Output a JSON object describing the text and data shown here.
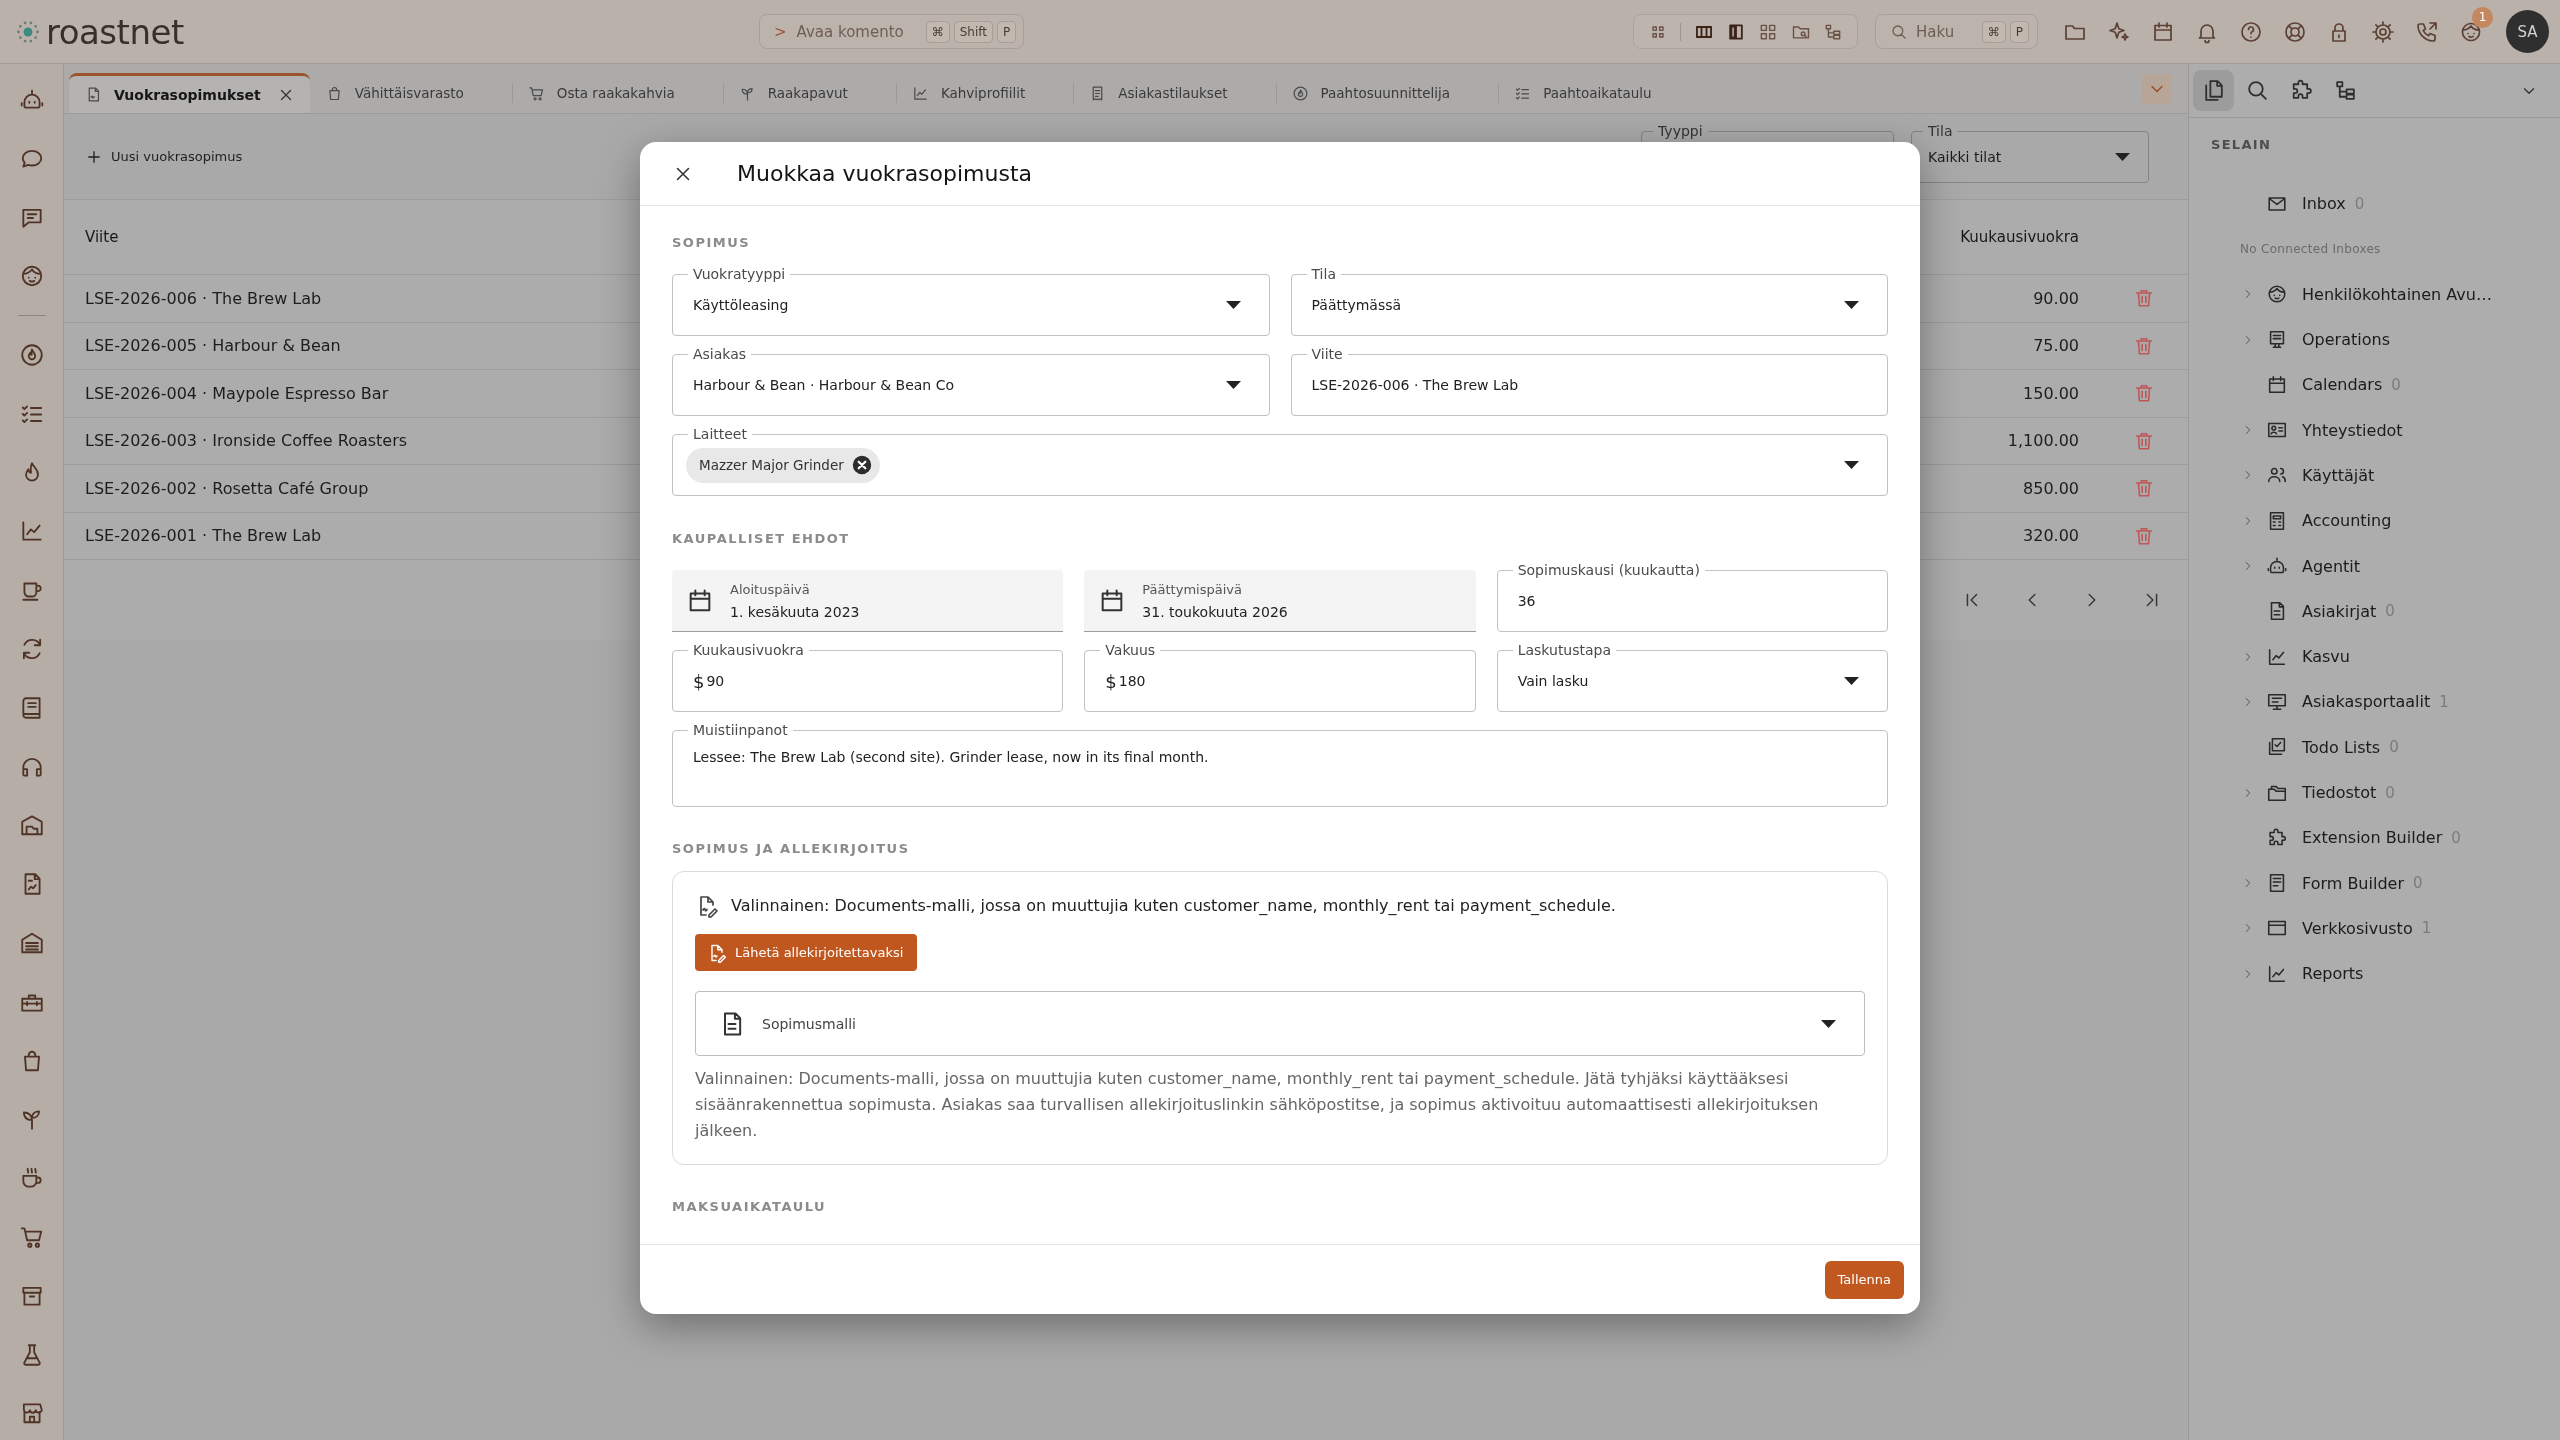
{
  "header": {
    "logo": "roastnet",
    "command": {
      "prompt": ">",
      "label": "Avaa komento",
      "keys": [
        "⌘",
        "Shift",
        "P"
      ]
    },
    "search": {
      "label": "Haku",
      "keys": [
        "⌘",
        "P"
      ]
    },
    "notification_badge": "1",
    "avatar": "SA"
  },
  "tabs": [
    {
      "kind": "contract",
      "label": "Vuokrasopimukset",
      "selected": true
    },
    {
      "kind": "bag",
      "label": "Vähittäisvarasto",
      "selected": false
    },
    {
      "kind": "cart",
      "label": "Osta raakakahvia",
      "selected": false
    },
    {
      "kind": "sprout",
      "label": "Raakapavut",
      "selected": false
    },
    {
      "kind": "linechart",
      "label": "Kahviprofiilit",
      "selected": false
    },
    {
      "kind": "receipt",
      "label": "Asiakastilaukset",
      "selected": false
    },
    {
      "kind": "flamecircle",
      "label": "Paahtosuunnittelija",
      "selected": false
    },
    {
      "kind": "checklist",
      "label": "Paahtoaikataulu",
      "selected": false
    }
  ],
  "toolbar": {
    "new_button": "Uusi vuokrasopimus",
    "filters": [
      {
        "label": "Tyyppi"
      },
      {
        "label": "Tila",
        "value": "Kaikki tilat"
      }
    ]
  },
  "table": {
    "columns": [
      "Viite",
      "Kuukausivuokra"
    ],
    "rows": [
      {
        "reference": "LSE-2026-006 · The Brew Lab",
        "monthly_rent": "90.00"
      },
      {
        "reference": "LSE-2026-005 · Harbour & Bean",
        "monthly_rent": "75.00"
      },
      {
        "reference": "LSE-2026-004 · Maypole Espresso Bar",
        "monthly_rent": "150.00"
      },
      {
        "reference": "LSE-2026-003 · Ironside Coffee Roasters",
        "monthly_rent": "1,100.00"
      },
      {
        "reference": "LSE-2026-002 · Rosetta Café Group",
        "monthly_rent": "850.00"
      },
      {
        "reference": "LSE-2026-001 · The Brew Lab",
        "monthly_rent": "320.00"
      }
    ]
  },
  "modal": {
    "title": "Muokkaa vuokrasopimusta",
    "contract": {
      "heading": "SOPIMUS",
      "fields": [
        {
          "kind": "select",
          "label": "Vuokratyyppi",
          "value": "Käyttöleasing"
        },
        {
          "kind": "select",
          "label": "Tila",
          "value": "Päättymässä"
        },
        {
          "kind": "select",
          "label": "Asiakas",
          "value": "Harbour & Bean · Harbour & Bean Co"
        },
        {
          "kind": "text",
          "label": "Viite",
          "value": "LSE-2026-006 · The Brew Lab"
        },
        {
          "kind": "chips",
          "label": "Laitteet",
          "chips": [
            "Mazzer Major Grinder"
          ]
        }
      ]
    },
    "commercial_terms": {
      "heading": "KAUPALLISET EHDOT",
      "fields": [
        {
          "kind": "date",
          "label": "Aloituspäivä",
          "value": "1. kesäkuuta 2023"
        },
        {
          "kind": "date",
          "label": "Päättymispäivä",
          "value": "31. toukokuuta 2026"
        },
        {
          "kind": "text",
          "label": "Sopimuskausi (kuukautta)",
          "value": "36"
        },
        {
          "kind": "money",
          "label": "Kuukausivuokra",
          "currency": "$",
          "value": "90"
        },
        {
          "kind": "money",
          "label": "Vakuus",
          "currency": "$",
          "value": "180"
        },
        {
          "kind": "select",
          "label": "Laskutustapa",
          "value": "Vain lasku"
        },
        {
          "kind": "textarea",
          "label": "Muistiinpanot",
          "value": "Lessee: The Brew Lab (second site). Grinder lease, now in its final month."
        }
      ]
    },
    "signature": {
      "heading": "SOPIMUS JA ALLEKIRJOITUS",
      "intro": "Valinnainen: Documents-malli, jossa on muuttujia kuten customer_name, monthly_rent tai payment_schedule.",
      "send_button": "Lähetä allekirjoitettavaksi",
      "template": {
        "placeholder": "Sopimusmalli"
      },
      "help": "Valinnainen: Documents-malli, jossa on muuttujia kuten customer_name, monthly_rent tai payment_schedule. Jätä tyhjäksi käyttääksesi sisäänrakennettua sopimusta. Asiakas saa turvallisen allekirjoituslinkin sähköpostitse, ja sopimus aktivoituu automaattisesti allekirjoituksen jälkeen."
    },
    "payment_schedule": {
      "heading": "MAKSUAIKATAULU"
    },
    "save_button": "Tallenna"
  },
  "browser": {
    "tabs": [
      {
        "kind": "files",
        "selected": true
      },
      {
        "kind": "search",
        "selected": false
      },
      {
        "kind": "puzzle",
        "selected": false
      },
      {
        "kind": "tree",
        "selected": false
      }
    ],
    "heading": "SELAIN",
    "inbox": {
      "label": "Inbox",
      "count": "0"
    },
    "inbox_note": "No Connected Inboxes",
    "items": [
      {
        "kind": "face",
        "label": "Henkilökohtainen Avu…",
        "expanded": false
      },
      {
        "kind": "monitor",
        "label": "Operations",
        "expanded": false
      },
      {
        "kind": "calendar",
        "label": "Calendars",
        "count": "0"
      },
      {
        "kind": "contact",
        "label": "Yhteystiedot",
        "expanded": false
      },
      {
        "kind": "users",
        "label": "Käyttäjät",
        "expanded": false
      },
      {
        "kind": "calculator",
        "label": "Accounting",
        "expanded": false
      },
      {
        "kind": "robot",
        "label": "Agentit",
        "expanded": false
      },
      {
        "kind": "document",
        "label": "Asiakirjat",
        "count": "0"
      },
      {
        "kind": "linechart",
        "label": "Kasvu",
        "expanded": false
      },
      {
        "kind": "presentation",
        "label": "Asiakasportaalit",
        "count": "1",
        "expanded": false
      },
      {
        "kind": "todo",
        "label": "Todo Lists",
        "count": "0"
      },
      {
        "kind": "folders",
        "label": "Tiedostot",
        "count": "0",
        "expanded": false
      },
      {
        "kind": "puzzle",
        "label": "Extension Builder",
        "count": "0"
      },
      {
        "kind": "form",
        "label": "Form Builder",
        "count": "0",
        "expanded": false
      },
      {
        "kind": "browser",
        "label": "Verkkosivusto",
        "count": "1",
        "expanded": false
      },
      {
        "kind": "linechart",
        "label": "Reports",
        "expanded": false
      }
    ]
  }
}
